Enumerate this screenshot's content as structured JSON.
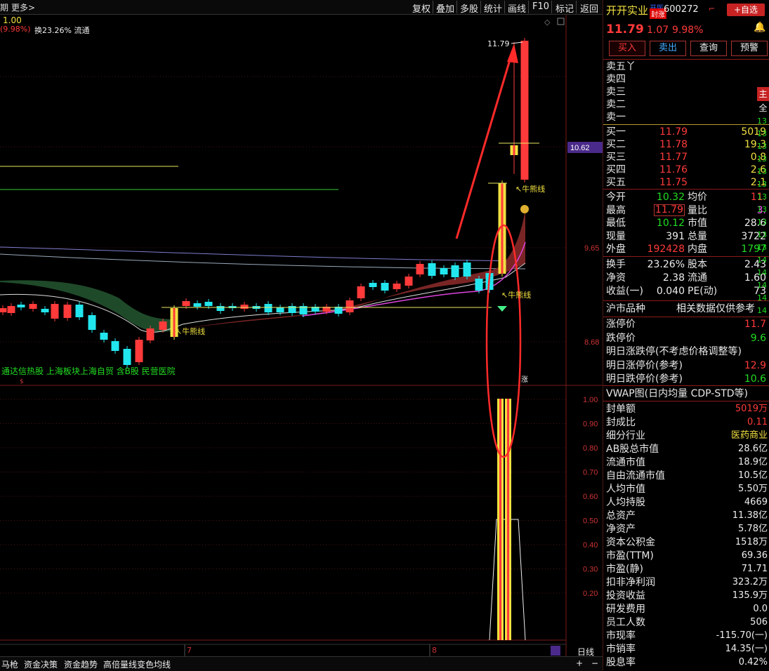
{
  "topbar": {
    "period_label": "期",
    "more_label": "更多>",
    "buttons": [
      "复权",
      "叠加",
      "多股",
      "统计",
      "画线",
      "F10",
      "标记",
      "返回"
    ]
  },
  "subline": {
    "value": "1.00",
    "change_pct": "(9.98%)",
    "text": "换23.26% 流通"
  },
  "stock": {
    "name": "开开实业",
    "code": "600272",
    "tag_top": "开医",
    "tag_bottom": "封涨",
    "add_label": "+自选",
    "price": "11.79",
    "change": "1.07",
    "change_pct": "9.98%",
    "actions": [
      "买入",
      "卖出",
      "查询",
      "预警"
    ]
  },
  "orderbook": {
    "sells": [
      {
        "label": "卖五",
        "extra": "丫"
      },
      {
        "label": "卖四"
      },
      {
        "label": "卖三"
      },
      {
        "label": "卖二"
      },
      {
        "label": "卖一"
      }
    ],
    "buys": [
      {
        "label": "买一",
        "price": "11.79",
        "vol": "5019"
      },
      {
        "label": "买二",
        "price": "11.78",
        "vol": "19.3"
      },
      {
        "label": "买三",
        "price": "11.77",
        "vol": "0.8"
      },
      {
        "label": "买四",
        "price": "11.76",
        "vol": "2.6"
      },
      {
        "label": "买五",
        "price": "11.75",
        "vol": "2.1"
      }
    ]
  },
  "quote": [
    {
      "l1": "今开",
      "v1": "10.32",
      "c1": "grn",
      "l2": "均价",
      "v2": "11.",
      "c2": "red"
    },
    {
      "l1": "最高",
      "v1": "11.79",
      "c1": "red",
      "l2": "量比",
      "v2": "3.",
      "c2": "mag"
    },
    {
      "l1": "最低",
      "v1": "10.12",
      "c1": "grn",
      "l2": "市值",
      "v2": "28.6",
      "c2": "wht"
    },
    {
      "l1": "现量",
      "v1": "391",
      "c1": "wht",
      "l2": "总量",
      "v2": "3722",
      "c2": "wht"
    },
    {
      "l1": "外盘",
      "v1": "192428",
      "c1": "red",
      "l2": "内盘",
      "v2": "1797",
      "c2": "grn"
    }
  ],
  "quote2": [
    {
      "l1": "换手",
      "v1": "23.26%",
      "l2": "股本",
      "v2": "2.43"
    },
    {
      "l1": "净资",
      "v1": "2.38",
      "l2": "流通",
      "v2": "1.60"
    },
    {
      "l1": "收益(一)",
      "v1": "0.040",
      "l2": "PE(动)",
      "v2": "73"
    }
  ],
  "market": {
    "left": "沪市品种",
    "right": "相关数据仅供参考"
  },
  "limits": [
    {
      "label": "涨停价",
      "value": "11.7",
      "color": "red"
    },
    {
      "label": "跌停价",
      "value": "9.6",
      "color": "grn"
    },
    {
      "label": "明日涨跌停(不考虑价格调整等)",
      "value": "",
      "color": "wht"
    },
    {
      "label": "明日涨停价(参考)",
      "value": "12.9",
      "color": "red"
    },
    {
      "label": "明日跌停价(参考)",
      "value": "10.6",
      "color": "grn"
    }
  ],
  "vwap": {
    "label": "VWAP图(日内均量 CDP-STD等)"
  },
  "fundamentals": [
    {
      "label": "封单额",
      "value": "5019万",
      "color": "red"
    },
    {
      "label": "封成比",
      "value": "0.11",
      "color": "red"
    },
    {
      "label": "细分行业",
      "value": "医药商业",
      "color": "yel"
    },
    {
      "label": "AB股总市值",
      "value": "28.6亿",
      "color": "wht"
    },
    {
      "label": "流通市值",
      "value": "18.9亿",
      "color": "wht"
    },
    {
      "label": "自由流通市值",
      "value": "10.5亿",
      "color": "wht"
    },
    {
      "label": "人均市值",
      "value": "5.50万",
      "color": "wht"
    },
    {
      "label": "人均持股",
      "value": "4669",
      "color": "wht"
    },
    {
      "label": "总资产",
      "value": "11.38亿",
      "color": "wht"
    },
    {
      "label": "净资产",
      "value": "5.78亿",
      "color": "wht"
    },
    {
      "label": "资本公积金",
      "value": "1518万",
      "color": "wht"
    },
    {
      "label": "市盈(TTM)",
      "value": "69.36",
      "color": "wht"
    },
    {
      "label": "市盈(静)",
      "value": "71.71",
      "color": "wht"
    },
    {
      "label": "扣非净利润",
      "value": "323.2万",
      "color": "wht"
    },
    {
      "label": "投资收益",
      "value": "135.9万",
      "color": "wht"
    },
    {
      "label": "研发费用",
      "value": "0.0",
      "color": "wht"
    },
    {
      "label": "员工人数",
      "value": "506",
      "color": "wht"
    },
    {
      "label": "市现率",
      "value": "-115.70(一)",
      "color": "wht"
    },
    {
      "label": "市销率",
      "value": "14.35(一)",
      "color": "wht"
    },
    {
      "label": "股息率",
      "value": "0.42%",
      "color": "wht"
    }
  ],
  "sidebar": {
    "tab1": "主",
    "tab2": "全",
    "items": [
      "13",
      "13",
      "13",
      "13",
      "13",
      "13",
      "13",
      "13",
      "13",
      "13",
      "13",
      "14",
      "14",
      "14",
      "14",
      "14"
    ]
  },
  "bottombar": {
    "items": [
      "马枪",
      "资金决策",
      "资金趋势",
      "高倍量线变色均线"
    ],
    "period": "日线"
  },
  "chart_data": {
    "type": "candlestick",
    "price_axis": {
      "ticks": [
        "10.62",
        "9.65",
        "8.68"
      ],
      "high_label": "11.79"
    },
    "indicator_axis": {
      "ticks": [
        "1.00",
        "0.90",
        "0.80",
        "0.70",
        "0.60",
        "0.50",
        "0.40",
        "0.30",
        "0.20"
      ],
      "range": [
        0,
        1
      ]
    },
    "x_labels": [
      "7",
      "8"
    ],
    "annotations": [
      "牛熊线",
      "牛熊线",
      "牛熊线"
    ],
    "concept_text": "通达信热股 上海板块上海自贸 含B股 民营医院",
    "colors": {
      "up": "#ff3a3a",
      "down": "#22e6ee",
      "limit_up": "#f0e040"
    }
  }
}
